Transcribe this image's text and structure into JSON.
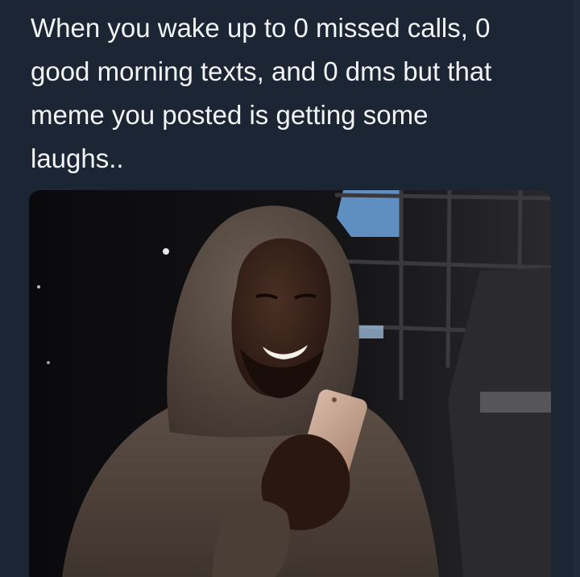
{
  "post": {
    "caption_lines": [
      "When you wake up to 0 missed calls, 0",
      "good morning texts, and 0 dms but that",
      "meme you posted is getting some",
      "laughs.."
    ]
  },
  "colors": {
    "background": "#1c2533",
    "caption_text": "#f2f4f6",
    "hoodie": "#5a4d44",
    "phone": "#c9a592"
  }
}
